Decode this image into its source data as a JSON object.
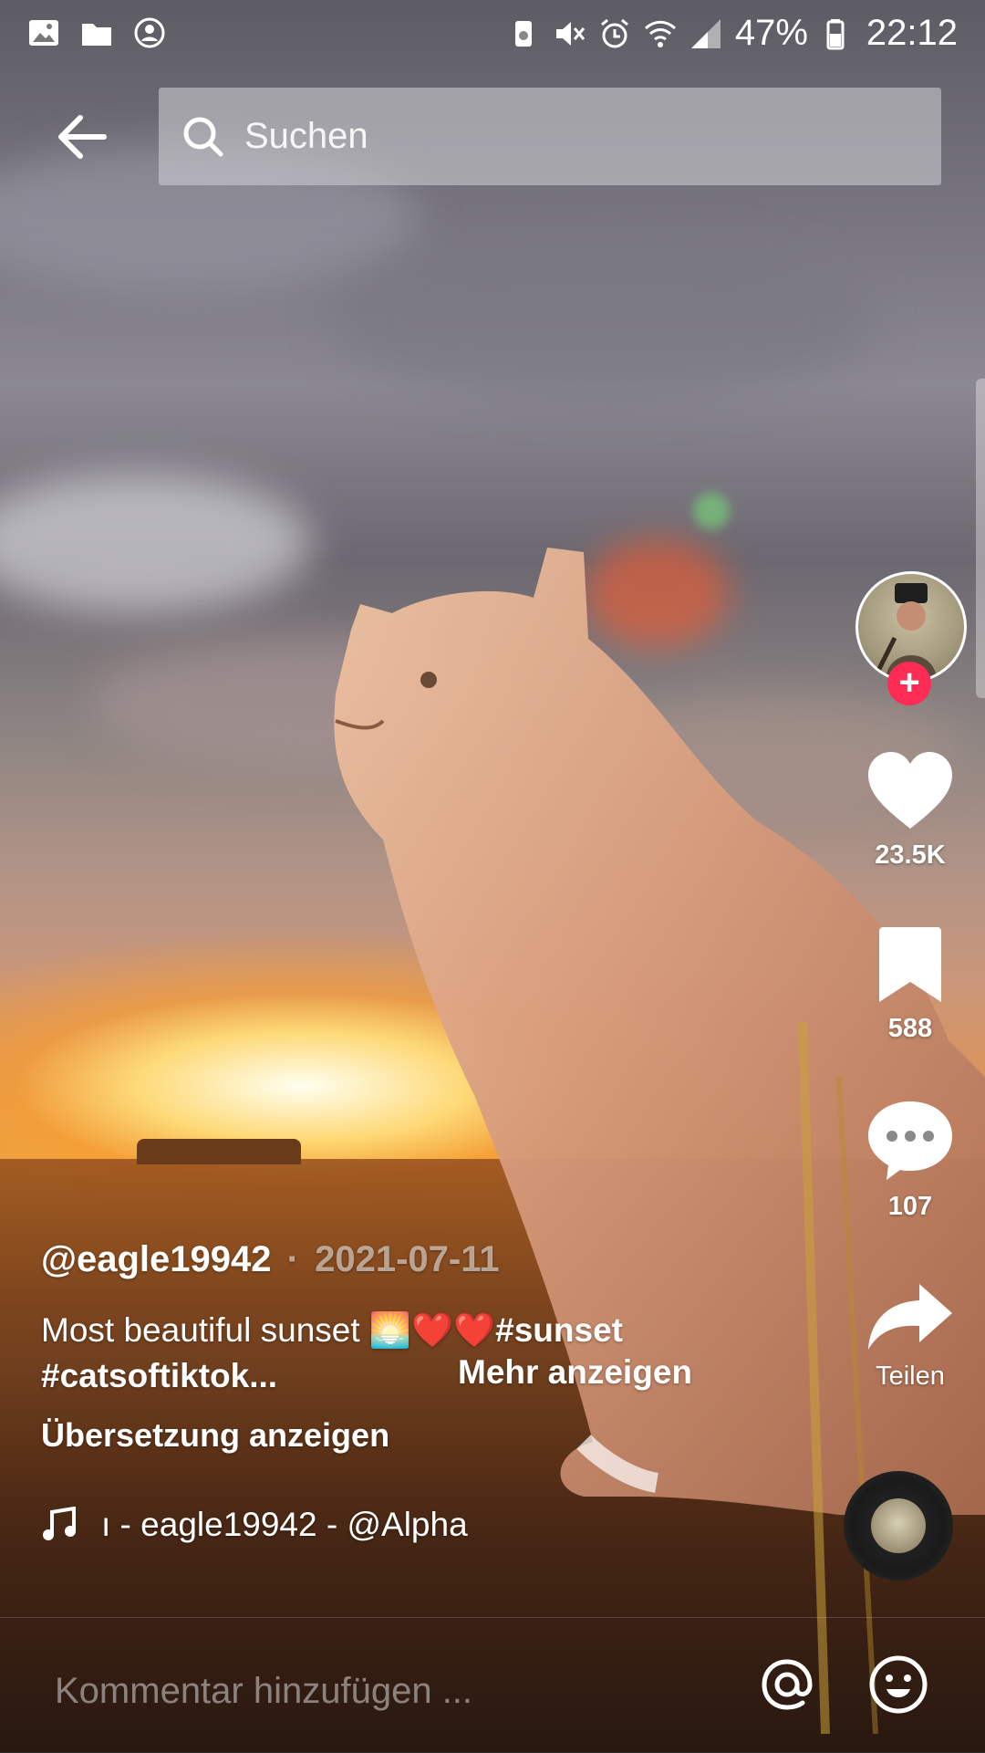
{
  "status_bar": {
    "battery": "47%",
    "time": "22:12"
  },
  "top_bar": {
    "search_placeholder": "Suchen"
  },
  "rail": {
    "likes": "23.5K",
    "saves": "588",
    "comments": "107",
    "share_label": "Teilen"
  },
  "post": {
    "username": "@eagle19942",
    "separator": "·",
    "date": "2021-07-11",
    "description_text": "Most beautiful sunset 🌅❤️❤️",
    "hashtag_1": "#sunset",
    "hashtag_2": "#catsoftiktok...",
    "more_label": "Mehr anzeigen",
    "translate_label": "Übersetzung anzeigen",
    "music": "ı - eagle19942 - @Alpha"
  },
  "comment_bar": {
    "placeholder": "Kommentar hinzufügen ..."
  },
  "icons": [
    "gallery-icon",
    "folder-icon",
    "account-icon",
    "battery-saver-icon",
    "mute-icon",
    "alarm-icon",
    "wifi-icon",
    "signal-icon",
    "battery-icon",
    "back-arrow-icon",
    "search-icon",
    "heart-icon",
    "bookmark-icon",
    "comment-icon",
    "share-icon",
    "music-note-icon",
    "at-icon",
    "emoji-icon"
  ],
  "colors": {
    "follow_accent": "#fe2c55"
  }
}
